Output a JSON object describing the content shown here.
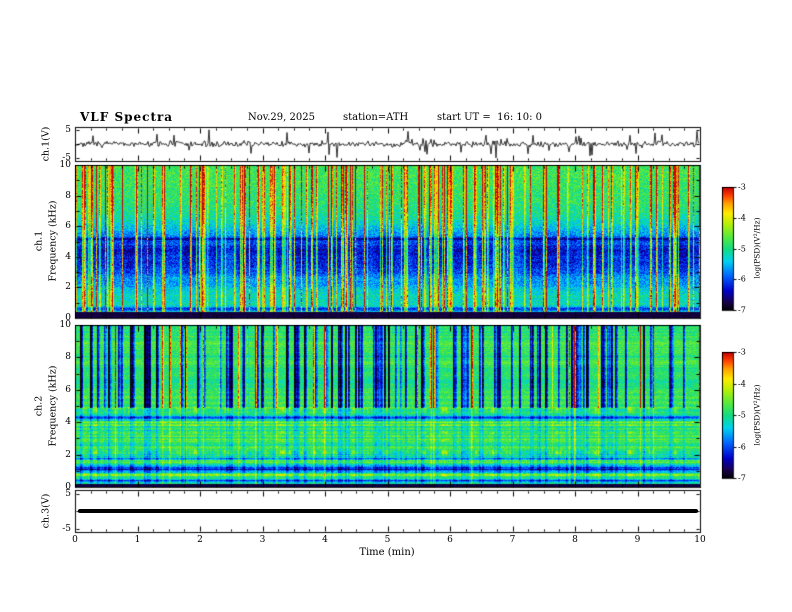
{
  "header": {
    "title": "VLF Spectra",
    "date": "Nov.29, 2025",
    "station": "station=ATH",
    "start_ut": "start UT =  16: 10: 0"
  },
  "xaxis": {
    "label": "Time (min)",
    "ticks": [
      0,
      1,
      2,
      3,
      4,
      5,
      6,
      7,
      8,
      9,
      10
    ],
    "range": [
      0,
      10
    ]
  },
  "panels": {
    "waveform": {
      "ylabel": "ch.1(V)",
      "yticks": [
        5,
        -5
      ],
      "ylim": [
        -5,
        5
      ]
    },
    "spec1": {
      "channel": "ch.1",
      "ylabel": "Frequency (kHz)",
      "yticks": [
        0,
        2,
        4,
        6,
        8,
        10
      ],
      "ylim": [
        0,
        10
      ]
    },
    "spec2": {
      "channel": "ch.2",
      "ylabel": "Frequency (kHz)",
      "yticks": [
        0,
        2,
        4,
        6,
        8,
        10
      ],
      "ylim": [
        0,
        10
      ]
    },
    "ch3": {
      "ylabel": "ch.3(V)",
      "yticks": [
        5,
        -5
      ],
      "ylim": [
        -5,
        5
      ]
    }
  },
  "colorbars": {
    "label": "log(PSD)(V²/Hz)",
    "ticks": [
      -3,
      -4,
      -5,
      -6,
      -7
    ],
    "range": [
      -7,
      -3
    ]
  },
  "chart_data": [
    {
      "type": "line",
      "name": "ch.1 voltage time series",
      "xlabel": "Time (min)",
      "ylabel": "ch.1(V)",
      "xlim": [
        0,
        10
      ],
      "ylim": [
        -5,
        5
      ],
      "yticks": [
        5,
        -5
      ],
      "description": "Black broadband noise trace centred on 0 V with dense impulsive sferic spikes reaching about ±4 to ±5 V throughout the 10-minute record."
    },
    {
      "type": "heatmap",
      "name": "ch.1 VLF spectrogram",
      "xlabel": "Time (min)",
      "ylabel": "Frequency (kHz)",
      "xlim": [
        0,
        10
      ],
      "ylim": [
        0,
        10
      ],
      "zlabel": "log(PSD)(V²/Hz)",
      "zlim": [
        -7,
        -3
      ],
      "features": [
        "green background power near -5",
        "dense vertical broadband sferic streaks (yellow to red, -4 to -3) spanning 0-10 kHz",
        "patchy low-power blue region (about -6) concentrated between roughly 2.5 and 5.5 kHz",
        "near-zero power black band (about -7) below roughly 0.5 kHz"
      ]
    },
    {
      "type": "heatmap",
      "name": "ch.2 VLF spectrogram",
      "xlabel": "Time (min)",
      "ylabel": "Frequency (kHz)",
      "xlim": [
        0,
        10
      ],
      "ylim": [
        0,
        10
      ],
      "zlabel": "log(PSD)(V²/Hz)",
      "zlim": [
        -7,
        -3
      ],
      "features": [
        "green background power near -5",
        "many dark blue vertical dropout streaks above about 5 kHz plus occasional bright yellow streaks",
        "horizontal interference bands below 5 kHz: bright yellow/red dashed lines near 4.8, 3.4-3.9 and 2.1-2.2 kHz; dark blue bands near 4.3, 1.0-1.4 and 0.5 kHz",
        "black band (about -7) below roughly 0.2 kHz"
      ]
    },
    {
      "type": "line",
      "name": "ch.3 voltage time series",
      "xlabel": "Time (min)",
      "ylabel": "ch.3(V)",
      "xlim": [
        0,
        10
      ],
      "ylim": [
        -5,
        5
      ],
      "yticks": [
        5,
        -5
      ],
      "description": "Flat thick black line at 0 V for the entire record (channel flat / no signal)."
    }
  ],
  "render": {
    "wave": {
      "seed": 7,
      "noise_sigma": 0.5,
      "spike_prob": 0.07
    },
    "spec1": {
      "seed": 101,
      "bright_density": 0.22,
      "dark_density": 0,
      "blue": [
        4.1,
        1.35,
        0.42
      ],
      "bands": [
        [
          5.2,
          0.06,
          -0.18
        ],
        [
          0.62,
          0.1,
          -0.25
        ]
      ],
      "base": 0.47,
      "tilt": 0.09,
      "pix_noise": 0.18,
      "row_noise": 0.05,
      "streak_full_above": 0,
      "streak_low_factor": 1,
      "black_below": 0.45
    },
    "spec2": {
      "seed": 202,
      "bright_density": 0.05,
      "dark_density": 0.17,
      "blue": null,
      "bands": [
        [
          4.78,
          0.12,
          0.32
        ],
        [
          4.3,
          0.09,
          -0.28
        ],
        [
          3.85,
          0.05,
          0.2
        ],
        [
          3.4,
          0.06,
          0.22
        ],
        [
          2.9,
          0.05,
          0.14
        ],
        [
          2.15,
          0.11,
          0.38
        ],
        [
          1.75,
          0.05,
          -0.2
        ],
        [
          1.15,
          0.16,
          -0.32
        ],
        [
          0.75,
          0.06,
          0.2
        ],
        [
          0.45,
          0.07,
          -0.26
        ]
      ],
      "base": 0.53,
      "tilt": 0.02,
      "pix_noise": 0.13,
      "row_noise": 0.2,
      "streak_full_above": 4.9,
      "streak_low_factor": 0.25,
      "black_below": 0.22
    }
  }
}
